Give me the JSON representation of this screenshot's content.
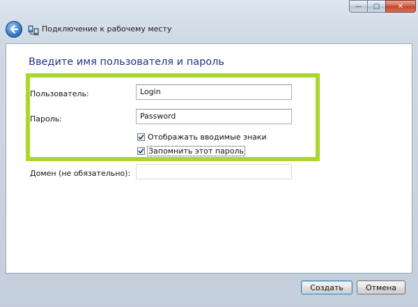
{
  "window": {
    "controls": {
      "minimize": "—",
      "maximize": "□",
      "close": "✕"
    }
  },
  "nav": {
    "back_icon": "back-arrow-icon",
    "app_icon": "network-connection-icon",
    "title": "Подключение к рабочему месту"
  },
  "main": {
    "heading": "Введите имя пользователя и пароль",
    "highlight_color": "#a9d82b",
    "user": {
      "label": "Пользователь:",
      "value": "Login"
    },
    "password": {
      "label": "Пароль:",
      "value": "Password"
    },
    "show_chars": {
      "label": "Отображать вводимые знаки",
      "checked": true
    },
    "remember": {
      "label": "Запомнить этот пароль",
      "checked": true
    },
    "domain": {
      "label": "Домен (не обязательно):",
      "value": ""
    }
  },
  "footer": {
    "create_label": "Создать",
    "cancel_label": "Отмена"
  }
}
